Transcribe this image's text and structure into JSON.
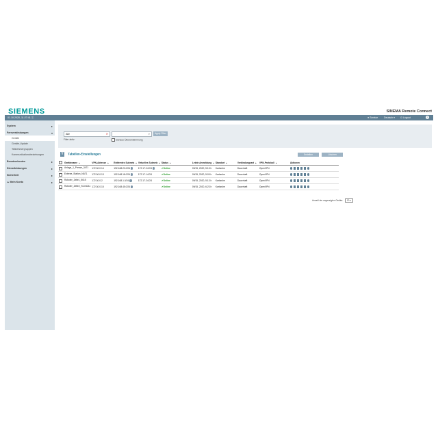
{
  "brand": {
    "logo": "SIEMENS",
    "product": "SINEMA Remote Connect"
  },
  "topbar": {
    "timestamp": "01.10.2020, 11:27:41 ⓘ",
    "user": "Service",
    "language": "Deutsch ▾",
    "logout": "Logout",
    "help": "?"
  },
  "sidebar": {
    "items": [
      {
        "label": "System",
        "arrow": "▸",
        "kind": "hdr"
      },
      {
        "label": "Fernverbindungen",
        "arrow": "▾",
        "kind": "hdr"
      },
      {
        "label": "Geräte",
        "kind": "sub"
      },
      {
        "label": "Geräte-Update",
        "kind": "sub"
      },
      {
        "label": "Teilnehmergruppen",
        "kind": "sub"
      },
      {
        "label": "Kommunikationsbeziehungen",
        "kind": "sub"
      },
      {
        "label": "Benutzerkonten",
        "arrow": "▸",
        "kind": "hdr"
      },
      {
        "label": "Dienstleistungen",
        "arrow": "▸",
        "kind": "hdr"
      },
      {
        "label": "Sicherheit",
        "arrow": "▸",
        "kind": "hdr"
      },
      {
        "label": "▲ Mein Konto",
        "arrow": "▸",
        "kind": "hdr"
      }
    ]
  },
  "filter": {
    "field1_value": "Alle",
    "clear_icon": "✕",
    "search_icon": "⌕",
    "apply_label": "Apply Filter",
    "filter_label": "Filter aktiv:",
    "exact_label": "Genaue Übereinstimmung"
  },
  "table_settings": {
    "filter_icon": "Y",
    "label": "Tabellen-Einstellungen"
  },
  "actions": {
    "create": "Erstellen",
    "delete": "Löschen"
  },
  "table": {
    "headers": [
      "Gerätename",
      "VPN-Adresse",
      "Entferntes Subnetz",
      "Virtuelles Subnetz",
      "Status",
      "Letzte Anmeldung",
      "Standort",
      "Verbindungsart",
      "VPN-Protokoll",
      "Aktionen"
    ],
    "rows": [
      [
        "Anlage_1_Presse_3471",
        "172.30.0.14",
        "192.168.20.0/24",
        "172.17.0.0/24",
        "Online",
        "09/15, 2020, 5:15 h",
        "Karlsruhe",
        "Dauerhaft",
        "OpenVPN"
      ],
      [
        "Externe_Station_NAT1",
        "172.30.0.13",
        "192.168.18.0/24",
        "172.17.1.0/24",
        "Online",
        "09/15, 2020, 5:09 h",
        "Karlsruhe",
        "Dauerhaft",
        "OpenVPN"
      ],
      [
        "Roboter_Zelle1_5615",
        "172.30.0.2",
        "192.168.1.0/24",
        "172.17.2.0/24",
        "Online",
        "09/15, 2020, 5:13 h",
        "Karlsruhe",
        "Dauerhaft",
        "OpenVPN"
      ],
      [
        "Roboter_Zelle2_SCX4211",
        "172.30.0.15",
        "192.168.45.0/24",
        "",
        "Online",
        "09/15, 2020, 6:23 h",
        "Karlsruhe",
        "Dauerhaft",
        "OpenVPN"
      ]
    ]
  },
  "pager": {
    "label": "Anzahl der angezeigten Geräte:",
    "value": "20 ▾"
  },
  "colors": {
    "brand": "#009999",
    "topbar": "#5f7f94",
    "sidebar": "#dbe4ea",
    "online": "#2a9a2a"
  }
}
